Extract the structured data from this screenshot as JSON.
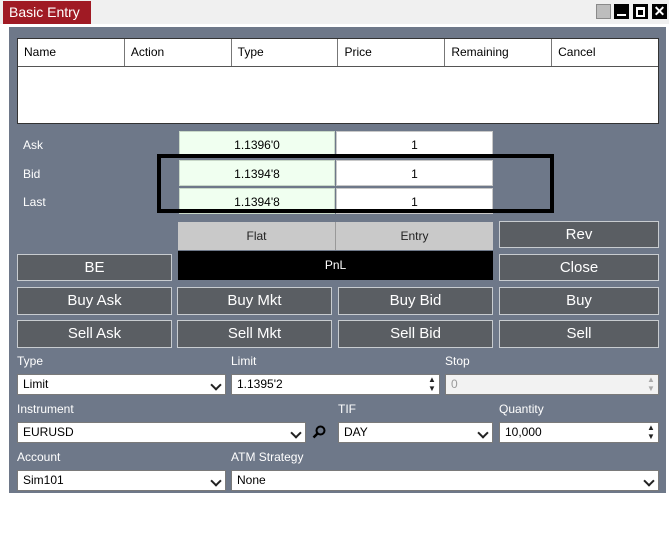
{
  "window": {
    "title": "Basic Entry"
  },
  "orders_table": {
    "columns": [
      "Name",
      "Action",
      "Type",
      "Price",
      "Remaining",
      "Cancel"
    ]
  },
  "quotes": {
    "ask": {
      "label": "Ask",
      "price": "1.1396'0",
      "size": "1"
    },
    "bid": {
      "label": "Bid",
      "price": "1.1394'8",
      "size": "1"
    },
    "last": {
      "label": "Last",
      "price": "1.1394'8",
      "size": "1"
    }
  },
  "position": {
    "flat_label": "Flat",
    "entry_label": "Entry",
    "pnl_label": "PnL"
  },
  "buttons": {
    "rev": "Rev",
    "be": "BE",
    "close": "Close",
    "buy_ask": "Buy Ask",
    "buy_mkt": "Buy Mkt",
    "buy_bid": "Buy Bid",
    "buy": "Buy",
    "sell_ask": "Sell Ask",
    "sell_mkt": "Sell Mkt",
    "sell_bid": "Sell Bid",
    "sell": "Sell"
  },
  "form": {
    "type_label": "Type",
    "type_value": "Limit",
    "limit_label": "Limit",
    "limit_value": "1.1395'2",
    "stop_label": "Stop",
    "stop_value": "0",
    "instrument_label": "Instrument",
    "instrument_value": "EURUSD",
    "tif_label": "TIF",
    "tif_value": "DAY",
    "quantity_label": "Quantity",
    "quantity_value": "10,000",
    "account_label": "Account",
    "account_value": "Sim101",
    "atm_label": "ATM Strategy",
    "atm_value": "None"
  },
  "colors": {
    "title_tab": "#a01a24",
    "panel": "#6e7889",
    "button": "#5a5e63",
    "quote_price_bg": "#f0fff0"
  }
}
